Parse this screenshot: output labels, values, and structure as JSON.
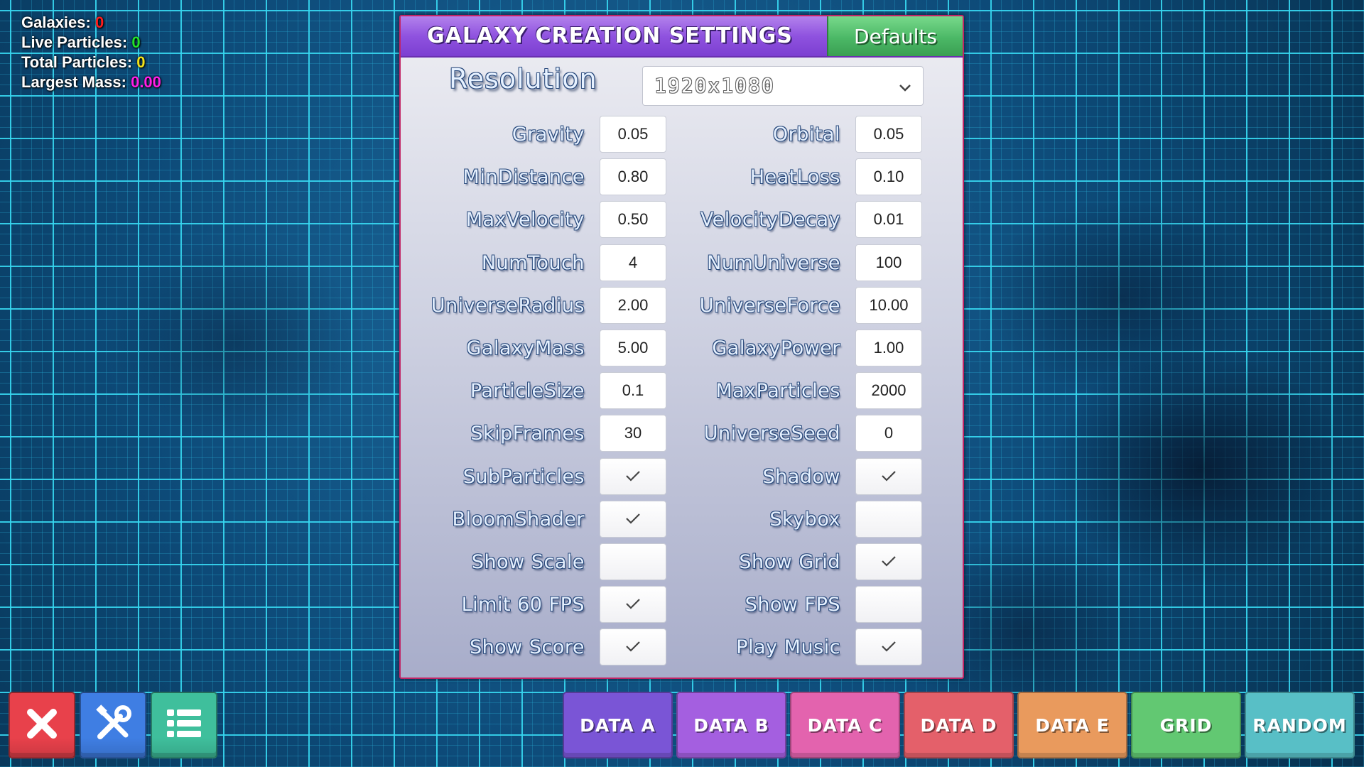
{
  "stats": [
    {
      "label": "Galaxies:",
      "value": "0",
      "color": "#ff1d1d"
    },
    {
      "label": "Live Particles:",
      "value": "0",
      "color": "#22e22a"
    },
    {
      "label": "Total Particles:",
      "value": "0",
      "color": "#f2e11a"
    },
    {
      "label": "Largest Mass:",
      "value": "0.00",
      "color": "#ff1ee6"
    }
  ],
  "panel": {
    "title": "GALAXY CREATION SETTINGS",
    "defaults_label": "Defaults",
    "resolution_label": "Resolution",
    "resolution_value": "1920x1080",
    "rows": [
      {
        "left": {
          "label": "Gravity",
          "value": "0.05"
        },
        "right": {
          "label": "Orbital",
          "value": "0.05"
        }
      },
      {
        "left": {
          "label": "MinDistance",
          "value": "0.80"
        },
        "right": {
          "label": "HeatLoss",
          "value": "0.10"
        }
      },
      {
        "left": {
          "label": "MaxVelocity",
          "value": "0.50"
        },
        "right": {
          "label": "VelocityDecay",
          "value": "0.01"
        }
      },
      {
        "left": {
          "label": "NumTouch",
          "value": "4"
        },
        "right": {
          "label": "NumUniverse",
          "value": "100"
        }
      },
      {
        "left": {
          "label": "UniverseRadius",
          "value": "2.00"
        },
        "right": {
          "label": "UniverseForce",
          "value": "10.00"
        }
      },
      {
        "left": {
          "label": "GalaxyMass",
          "value": "5.00"
        },
        "right": {
          "label": "GalaxyPower",
          "value": "1.00"
        }
      },
      {
        "left": {
          "label": "ParticleSize",
          "value": "0.1"
        },
        "right": {
          "label": "MaxParticles",
          "value": "2000"
        }
      },
      {
        "left": {
          "label": "SkipFrames",
          "value": "30"
        },
        "right": {
          "label": "UniverseSeed",
          "value": "0"
        }
      }
    ],
    "toggles": [
      {
        "left": {
          "label": "SubParticles",
          "checked": true
        },
        "right": {
          "label": "Shadow",
          "checked": true
        }
      },
      {
        "left": {
          "label": "BloomShader",
          "checked": true
        },
        "right": {
          "label": "Skybox",
          "checked": false
        }
      },
      {
        "left": {
          "label": "Show Scale",
          "checked": false
        },
        "right": {
          "label": "Show Grid",
          "checked": true
        }
      },
      {
        "left": {
          "label": "Limit 60 FPS",
          "checked": true
        },
        "right": {
          "label": "Show FPS",
          "checked": false
        }
      },
      {
        "left": {
          "label": "Show Score",
          "checked": true
        },
        "right": {
          "label": "Play Music",
          "checked": true
        }
      }
    ]
  },
  "toolbar": {
    "icon_buttons": [
      {
        "icon": "close-icon",
        "color": "#e8414b"
      },
      {
        "icon": "tools-icon",
        "color": "#3f7ee3"
      },
      {
        "icon": "list-icon",
        "color": "#3fbf9c"
      }
    ],
    "data_buttons": [
      {
        "label": "DATA A",
        "color": "#7a55d6"
      },
      {
        "label": "DATA B",
        "color": "#a45fe0"
      },
      {
        "label": "DATA C",
        "color": "#e363ae"
      },
      {
        "label": "DATA D",
        "color": "#e4606a"
      },
      {
        "label": "DATA E",
        "color": "#e99a5d"
      },
      {
        "label": "GRID",
        "color": "#62c872"
      },
      {
        "label": "RANDOM",
        "color": "#58bfc6"
      }
    ]
  }
}
